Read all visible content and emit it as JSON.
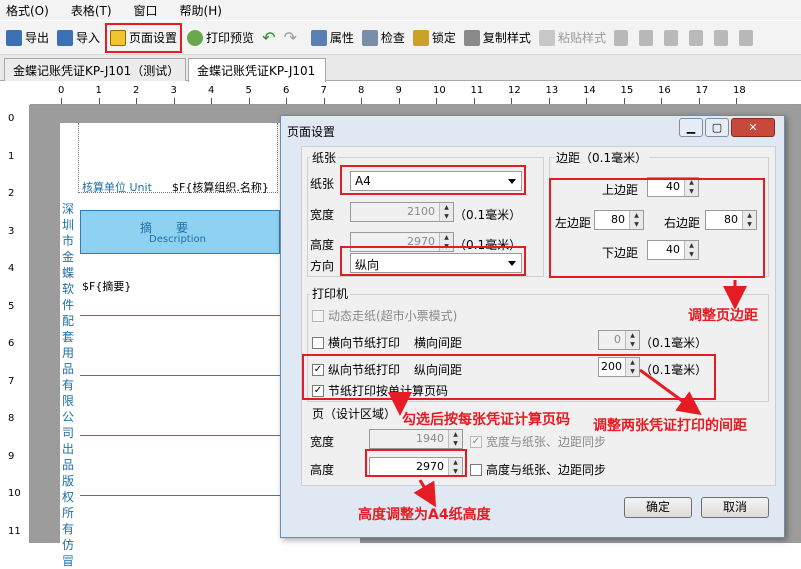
{
  "menubar": {
    "items": [
      "格式(O)",
      "表格(T)",
      "窗口",
      "帮助(H)"
    ]
  },
  "toolbar": {
    "export": "导出",
    "import": "导入",
    "page_setup": "页面设置",
    "print_preview": "打印预览",
    "properties": "属性",
    "check": "检查",
    "lock": "锁定",
    "copy_style": "复制样式",
    "paste_style": "粘贴样式"
  },
  "tabs": [
    "金蝶记账凭证KP-J101（测试）",
    "金蝶记账凭证KP-J101"
  ],
  "ruler": {
    "h": [
      "0",
      "1",
      "2",
      "3",
      "4",
      "5",
      "6",
      "7",
      "8",
      "9",
      "10",
      "11",
      "12",
      "13",
      "14",
      "15",
      "16",
      "17",
      "18"
    ],
    "v": [
      "0",
      "1",
      "2",
      "3",
      "4",
      "5",
      "6",
      "7",
      "8",
      "9",
      "10",
      "11"
    ]
  },
  "doc": {
    "side_text": "深圳市金蝶软件配套用品有限公司出品 版权所有 仿冒",
    "unit_label": "核算单位 Unit",
    "unit_field": "$F{核算组织.名称}",
    "header_cn": "摘　　要",
    "header_en": "Description",
    "summary_field": "$F{摘要}"
  },
  "dialog": {
    "title": "页面设置",
    "paper": {
      "group": "纸张",
      "paper_label": "纸张",
      "paper_value": "A4",
      "width_label": "宽度",
      "width_value": "2100",
      "height_label": "高度",
      "height_value": "2970",
      "unit": "（0.1毫米）",
      "orient_label": "方向",
      "orient_value": "纵向"
    },
    "margin": {
      "group": "边距（0.1毫米）",
      "top_label": "上边距",
      "top": "40",
      "left_label": "左边距",
      "left": "80",
      "right_label": "右边距",
      "right": "80",
      "bottom_label": "下边距",
      "bottom": "40"
    },
    "printer": {
      "group": "打印机",
      "dynamic": "动态走纸(超市小票模式)",
      "h_print": "横向节纸打印",
      "h_gap_label": "横向间距",
      "h_gap": "0",
      "v_print": "纵向节纸打印",
      "v_gap_label": "纵向间距",
      "v_gap": "200",
      "unit": "（0.1毫米）",
      "page_count": "节纸打印按单计算页码"
    },
    "design": {
      "group": "页（设计区域）",
      "width_label": "宽度",
      "width": "1940",
      "height_label": "高度",
      "height": "2970",
      "sync_w": "宽度与纸张、边距同步",
      "sync_h": "高度与纸张、边距同步"
    },
    "ok": "确定",
    "cancel": "取消"
  },
  "annotations": {
    "margins": "调整页边距",
    "page_count": "勾选后按每张凭证计算页码",
    "gap": "调整两张凭证打印的间距",
    "height": "高度调整为A4纸高度"
  },
  "colors": {
    "highlight": "#e51c23",
    "table_header": "#8fd1f0",
    "table_line": "#2f7db8"
  }
}
